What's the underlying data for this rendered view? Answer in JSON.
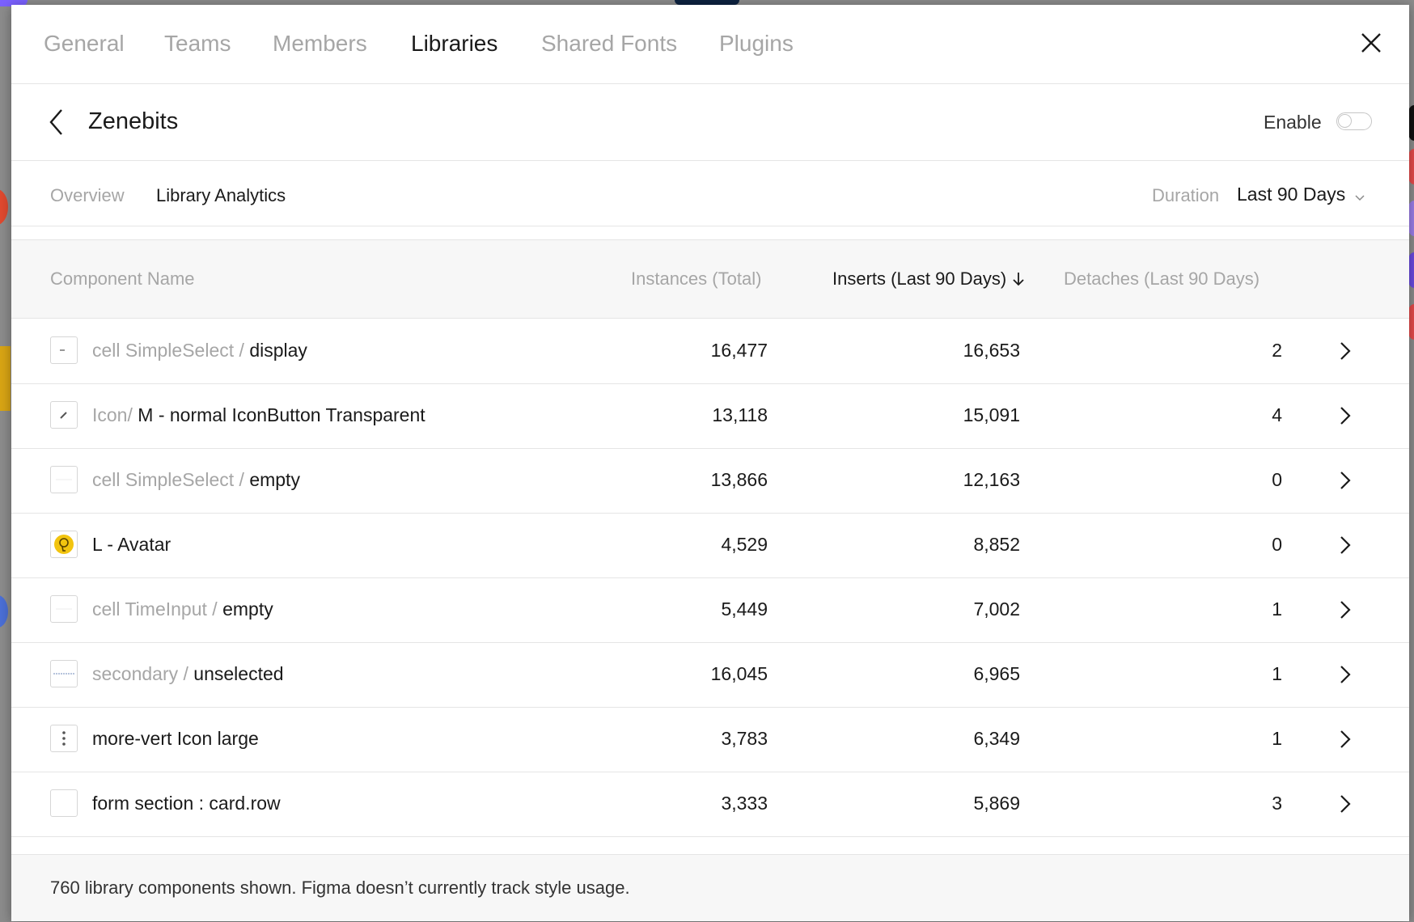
{
  "tabs": [
    {
      "id": "general",
      "label": "General"
    },
    {
      "id": "teams",
      "label": "Teams"
    },
    {
      "id": "members",
      "label": "Members"
    },
    {
      "id": "libraries",
      "label": "Libraries",
      "active": true
    },
    {
      "id": "shared-fonts",
      "label": "Shared Fonts"
    },
    {
      "id": "plugins",
      "label": "Plugins"
    }
  ],
  "library": {
    "name": "Zenebits",
    "enable_label": "Enable",
    "enabled": false
  },
  "subtabs": {
    "overview": "Overview",
    "analytics": "Library Analytics",
    "active": "analytics"
  },
  "duration": {
    "label": "Duration",
    "value": "Last 90 Days"
  },
  "table": {
    "headers": {
      "name": "Component Name",
      "instances": "Instances (Total)",
      "inserts": "Inserts (Last 90 Days)",
      "detaches": "Detaches (Last 90 Days)"
    },
    "sort_column": "inserts",
    "sort_direction": "desc",
    "rows": [
      {
        "prefix": "cell SimpleSelect / ",
        "name": "display",
        "instances": "16,477",
        "inserts": "16,653",
        "detaches": "2",
        "thumb": "dash"
      },
      {
        "prefix": "Icon/ ",
        "name": "M - normal IconButton Transparent",
        "instances": "13,118",
        "inserts": "15,091",
        "detaches": "4",
        "thumb": "pencil"
      },
      {
        "prefix": "cell SimpleSelect / ",
        "name": "empty",
        "instances": "13,866",
        "inserts": "12,163",
        "detaches": "0",
        "thumb": "faint"
      },
      {
        "prefix": "",
        "name": "L - Avatar",
        "instances": "4,529",
        "inserts": "8,852",
        "detaches": "0",
        "thumb": "avatar"
      },
      {
        "prefix": "cell TimeInput / ",
        "name": "empty",
        "instances": "5,449",
        "inserts": "7,002",
        "detaches": "1",
        "thumb": "faint"
      },
      {
        "prefix": "secondary / ",
        "name": "unselected",
        "instances": "16,045",
        "inserts": "6,965",
        "detaches": "1",
        "thumb": "tabtext"
      },
      {
        "prefix": "",
        "name": "more-vert Icon large",
        "instances": "3,783",
        "inserts": "6,349",
        "detaches": "1",
        "thumb": "dots"
      },
      {
        "prefix": "",
        "name": "form section : card.row",
        "instances": "3,333",
        "inserts": "5,869",
        "detaches": "3",
        "thumb": "blank"
      }
    ]
  },
  "footer": {
    "text": "760 library components shown. Figma doesn’t currently track style usage."
  },
  "colors": {
    "text_primary": "#1a1a1a",
    "text_muted": "#a6a6a6",
    "divider": "#e5e5e5",
    "header_bg": "#f7f7f7",
    "avatar_yellow": "#f2c40f"
  }
}
